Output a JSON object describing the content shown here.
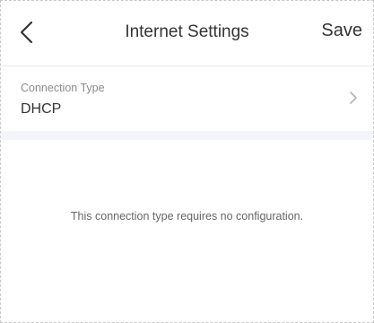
{
  "header": {
    "title": "Internet Settings",
    "save_label": "Save",
    "back_icon": "chevron-left-icon"
  },
  "connection": {
    "label": "Connection Type",
    "value": "DHCP",
    "chevron_icon": "chevron-right-icon"
  },
  "content": {
    "message": "This connection type requires no configuration."
  },
  "colors": {
    "text_primary": "#333333",
    "text_secondary": "#8a8a8a",
    "divider": "#e6e6e6",
    "section_band": "#f3f5f8"
  }
}
